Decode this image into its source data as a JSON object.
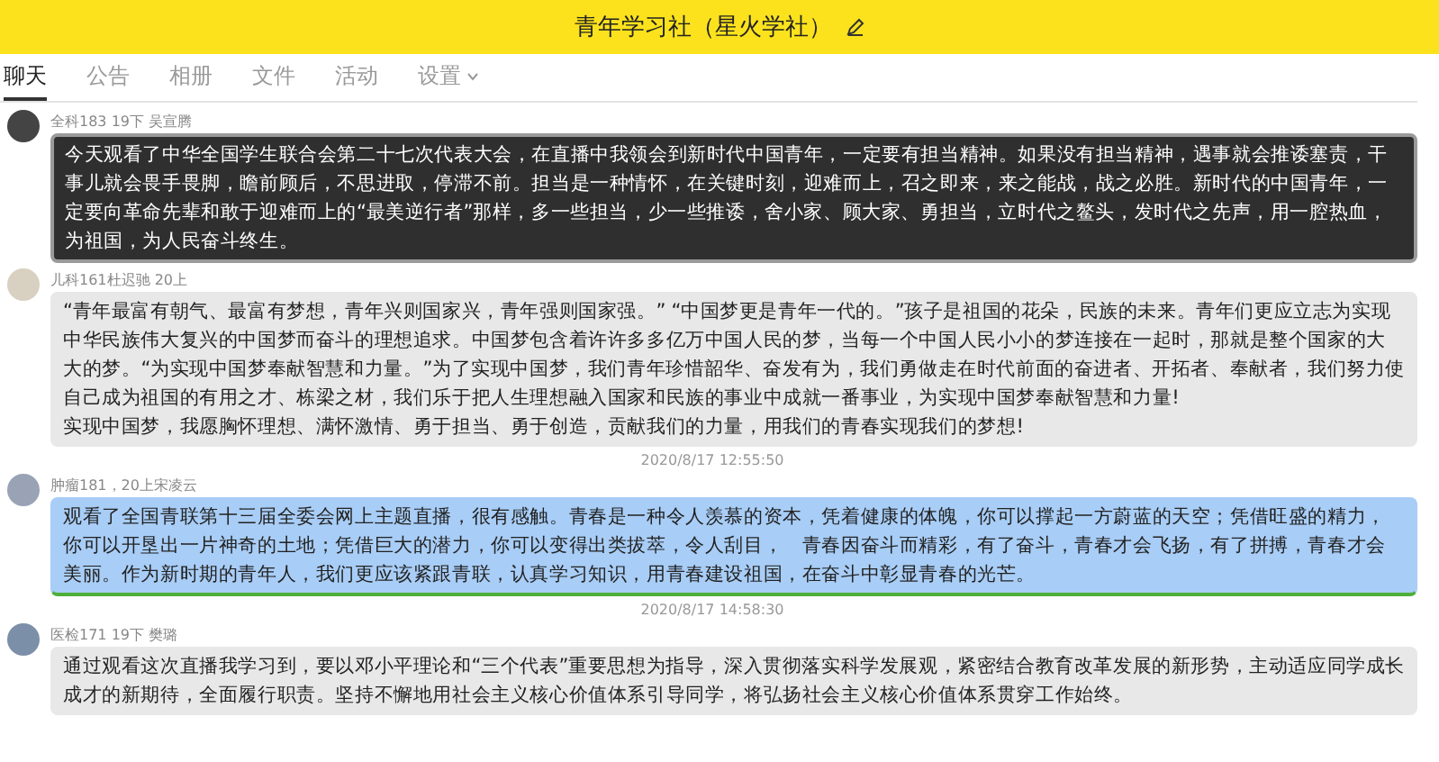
{
  "window": {
    "title": "青年学习社（星火学社）"
  },
  "tabs": [
    {
      "label": "聊天",
      "selected": true,
      "kind": "plain"
    },
    {
      "label": "公告",
      "selected": false,
      "kind": "plain"
    },
    {
      "label": "相册",
      "selected": false,
      "kind": "plain"
    },
    {
      "label": "文件",
      "selected": false,
      "kind": "plain"
    },
    {
      "label": "活动",
      "selected": false,
      "kind": "plain"
    },
    {
      "label": "设置",
      "selected": false,
      "kind": "menu"
    }
  ],
  "messages": [
    {
      "kind": "featured",
      "sender": "全科183 19下 吴宣腾",
      "paragraphs": [
        "今天观看了中华全国学生联合会第二十七次代表大会，在直播中我领会到新时代中国青年，一定要有担当精神。如果没有担当精神，遇事就会推诿塞责，干事儿就会畏手畏脚，瞻前顾后，不思进取，停滞不前。担当是一种情怀，在关键时刻，迎难而上，召之即来，来之能战，战之必胜。新时代的中国青年，一定要向革命先辈和敢于迎难而上的“最美逆行者”那样，多一些担当，少一些推诿，舍小家、顾大家、勇担当，立时代之鳌头，发时代之先声，用一腔热血，为祖国，为人民奋斗终生。"
      ]
    },
    {
      "kind": "plain",
      "sender": "儿科161杜迟驰 20上",
      "paragraphs": [
        "“青年最富有朝气、最富有梦想，青年兴则国家兴，青年强则国家强。” “中国梦更是青年一代的。”孩子是祖国的花朵，民族的未来。青年们更应立志为实现中华民族伟大复兴的中国梦而奋斗的理想追求。中国梦包含着许许多多亿万中国人民的梦，当每一个中国人民小小的梦连接在一起时，那就是整个国家的大大的梦。“为实现中国梦奉献智慧和力量。”为了实现中国梦，我们青年珍惜韶华、奋发有为，我们勇做走在时代前面的奋进者、开拓者、奉献者，我们努力使自己成为祖国的有用之才、栋梁之材，我们乐于把人生理想融入国家和民族的事业中成就一番事业，为实现中国梦奉献智慧和力量!",
        "实现中国梦，我愿胸怀理想、满怀激情、勇于担当、勇于创造，贡献我们的力量，用我们的青春实现我们的梦想!"
      ]
    },
    {
      "kind": "time",
      "text": "2020/8/17 12:55:50"
    },
    {
      "kind": "selected",
      "sender": "肿瘤181，20上宋凌云",
      "paragraphs": [
        "观看了全国青联第十三届全委会网上主题直播，很有感触。青春是一种令人羡慕的资本，凭着健康的体魄，你可以撑起一方蔚蓝的天空；凭借旺盛的精力，你可以开垦出一片神奇的土地；凭借巨大的潜力，你可以变得出类拔萃，令人刮目，　青春因奋斗而精彩，有了奋斗，青春才会飞扬，有了拼搏，青春才会美丽。作为新时期的青年人，我们更应该紧跟青联，认真学习知识，用青春建设祖国，在奋斗中彰显青春的光芒。"
      ]
    },
    {
      "kind": "time",
      "text": "2020/8/17 14:58:30"
    },
    {
      "kind": "plain",
      "sender": "医检171 19下 樊璐",
      "paragraphs": [
        "通过观看这次直播我学习到，要以邓小平理论和“三个代表”重要思想为指导，深入贯彻落实科学发展观，紧密结合教育改革发展的新形势，主动适应同学成长成才的新期待，全面履行职责。坚持不懈地用社会主义核心价值体系引导同学，将弘扬社会主义核心价值体系贯穿工作始终。"
      ]
    }
  ]
}
